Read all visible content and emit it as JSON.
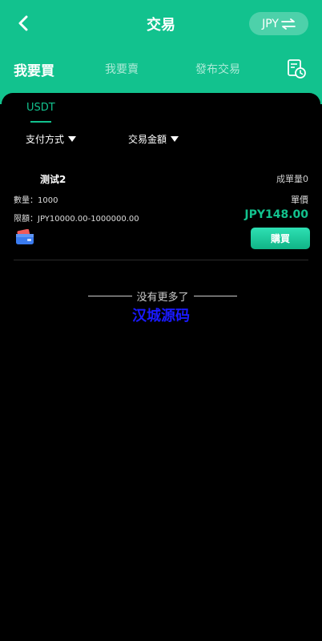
{
  "header": {
    "title": "交易",
    "currency_label": "JPY",
    "tabs": [
      {
        "label": "我要買",
        "active": true
      },
      {
        "label": "我要賣",
        "active": false
      },
      {
        "label": "發布交易",
        "active": false
      }
    ]
  },
  "filters": {
    "coin": "USDT",
    "payment_method": "支付方式",
    "amount": "交易金額"
  },
  "orders": [
    {
      "merchant": "测试2",
      "deals": "成單量0",
      "quantity": "數量：1000",
      "unit_price_label": "單價",
      "limit": "限額：JPY10000.00-1000000.00",
      "price": "JPY148.00",
      "buy_label": "購買"
    }
  ],
  "footer": {
    "no_more": "没有更多了",
    "watermark": "汉城源码"
  },
  "colors": {
    "accent": "#12c28e",
    "background": "#000000",
    "watermark": "#1a1aff"
  },
  "icons": {
    "back": "chevron-left-icon",
    "swap": "swap-arrows-icon",
    "history": "order-history-icon",
    "wallet": "wallet-card-icon"
  }
}
